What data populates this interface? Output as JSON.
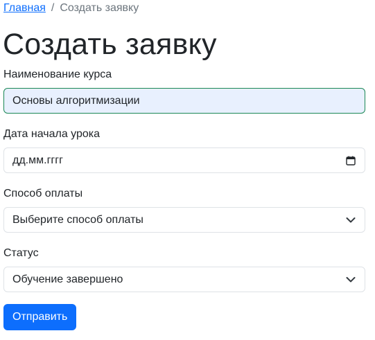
{
  "breadcrumb": {
    "home": "Главная",
    "separator": "/",
    "current": "Создать заявку"
  },
  "page": {
    "title": "Создать заявку"
  },
  "form": {
    "course": {
      "label": "Наименование курса",
      "value": "Основы алгоритмизации"
    },
    "date": {
      "label": "Дата начала урока",
      "placeholder": "дд.мм.гггг",
      "icon": "calendar-icon"
    },
    "payment": {
      "label": "Способ оплаты",
      "selected": "Выберите способ оплаты",
      "icon": "chevron-down-icon"
    },
    "status": {
      "label": "Статус",
      "selected": "Обучение завершено",
      "icon": "chevron-down-icon"
    },
    "submit_label": "Отправить"
  },
  "colors": {
    "link": "#0d6efd",
    "primary": "#0d6efd",
    "autofill_bg": "#e8f0fe",
    "valid_border": "#198754"
  }
}
